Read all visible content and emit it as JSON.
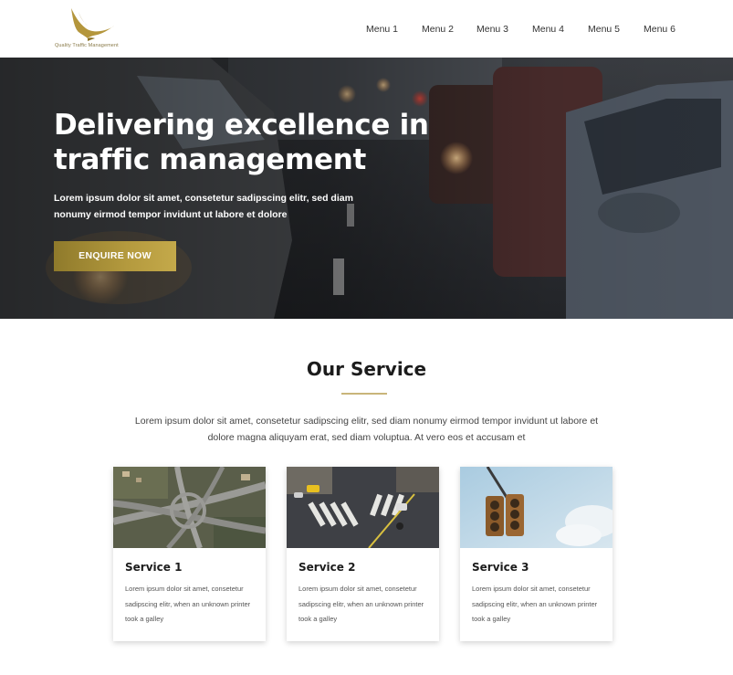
{
  "header": {
    "logo_text": "Quality Traffic Management",
    "nav": [
      "Menu 1",
      "Menu 2",
      "Menu 3",
      "Menu 4",
      "Menu 5",
      "Menu 6"
    ]
  },
  "hero": {
    "title": "Delivering excellence in traffic management",
    "text": "Lorem ipsum dolor sit amet, consetetur sadipscing elitr, sed diam nonumy eirmod tempor invidunt ut labore et dolore",
    "cta_label": "ENQUIRE NOW"
  },
  "services": {
    "title": "Our Service",
    "intro": "Lorem ipsum dolor sit amet, consetetur sadipscing elitr, sed diam nonumy eirmod tempor invidunt ut labore et dolore magna aliquyam erat, sed diam voluptua. At vero eos et accusam et",
    "cards": [
      {
        "title": "Service 1",
        "text": "Lorem ipsum dolor sit amet, consetetur sadipscing elitr, when an unknown printer took a galley",
        "image": "aerial-highway-interchange"
      },
      {
        "title": "Service 2",
        "text": "Lorem ipsum dolor sit amet, consetetur sadipscing elitr, when an unknown printer took a galley",
        "image": "city-crosswalk-intersection"
      },
      {
        "title": "Service 3",
        "text": "Lorem ipsum dolor sit amet, consetetur sadipscing elitr, when an unknown printer took a galley",
        "image": "traffic-light"
      }
    ]
  },
  "colors": {
    "accent_gold": "#b49a3e",
    "divider_gold": "#c9b57a",
    "text_dark": "#1c1c1c"
  }
}
